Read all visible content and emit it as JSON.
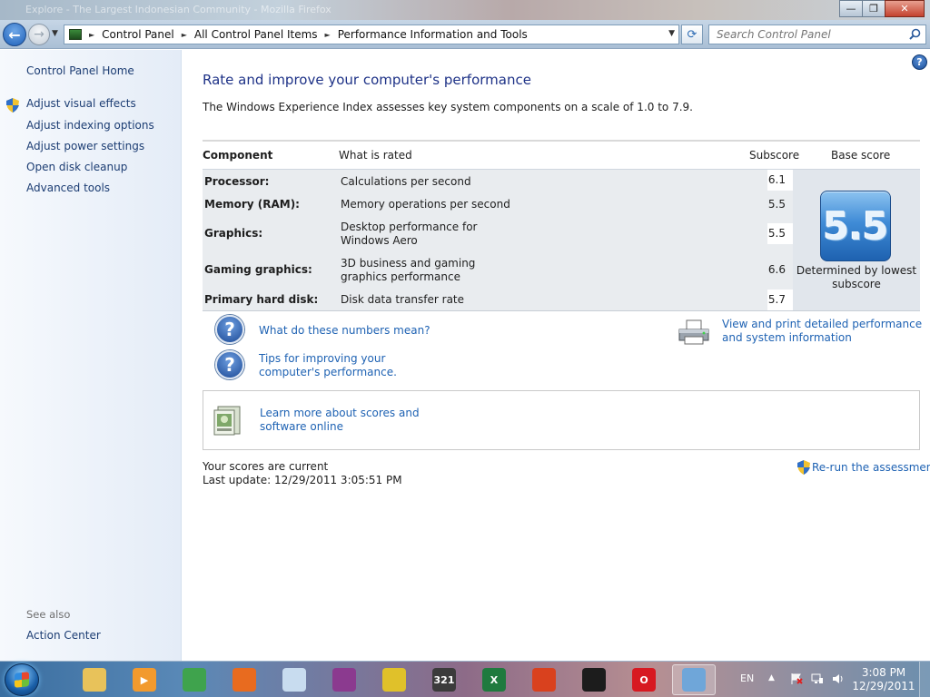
{
  "window": {
    "ghost_title": "Explore - The Largest Indonesian Community - Mozilla Firefox",
    "minimize": "—",
    "maximize": "❐",
    "close": "✕"
  },
  "nav": {
    "back_glyph": "←",
    "forward_glyph": "→",
    "recent_glyph": "▼",
    "breadcrumbs": [
      "Control Panel",
      "All Control Panel Items",
      "Performance Information and Tools"
    ],
    "crumb_sep": "►",
    "dropdown_glyph": "▼",
    "refresh_glyph": "⟳",
    "search_placeholder": "Search Control Panel"
  },
  "sidebar": {
    "home": "Control Panel Home",
    "items": [
      "Adjust visual effects",
      "Adjust indexing options",
      "Adjust power settings",
      "Open disk cleanup",
      "Advanced tools"
    ],
    "see_also_heading": "See also",
    "see_also_items": [
      "Action Center"
    ]
  },
  "main": {
    "help_glyph": "?",
    "title": "Rate and improve your computer's performance",
    "intro": "The Windows Experience Index assesses key system components on a scale of 1.0 to 7.9.",
    "table": {
      "headers": {
        "component": "Component",
        "rated": "What is rated",
        "subscore": "Subscore",
        "base": "Base score"
      },
      "rows": [
        {
          "component": "Processor:",
          "rated": "Calculations per second",
          "subscore": "6.1"
        },
        {
          "component": "Memory (RAM):",
          "rated": "Memory operations per second",
          "subscore": "5.5"
        },
        {
          "component": "Graphics:",
          "rated": "Desktop performance for Windows Aero",
          "subscore": "5.5"
        },
        {
          "component": "Gaming graphics:",
          "rated": "3D business and gaming graphics performance",
          "subscore": "6.6"
        },
        {
          "component": "Primary hard disk:",
          "rated": "Disk data transfer rate",
          "subscore": "5.7"
        }
      ],
      "base_score": "5.5",
      "base_caption": "Determined by lowest subscore"
    },
    "links": {
      "numbers": "What do these numbers mean?",
      "tips": "Tips for improving your computer's performance.",
      "print": "View and print detailed performance and system information",
      "learn": "Learn more about scores and software online"
    },
    "status": {
      "current": "Your scores are current",
      "last_update": "Last update: 12/29/2011 3:05:51 PM",
      "rerun": "Re-run the assessment"
    }
  },
  "taskbar": {
    "apps": [
      {
        "name": "explorer",
        "glyph": "",
        "color": "#e8c25a"
      },
      {
        "name": "media-player",
        "glyph": "▶",
        "color": "#f29a2e"
      },
      {
        "name": "idm",
        "glyph": "",
        "color": "#3fa34d"
      },
      {
        "name": "firefox",
        "glyph": "",
        "color": "#e86b1f"
      },
      {
        "name": "notes",
        "glyph": "",
        "color": "#c8dcef"
      },
      {
        "name": "winrar",
        "glyph": "",
        "color": "#8b3a8f"
      },
      {
        "name": "disc-burner",
        "glyph": "",
        "color": "#e0c12a"
      },
      {
        "name": "media-classic",
        "glyph": "321",
        "color": "#3b3b3b"
      },
      {
        "name": "excel",
        "glyph": "X",
        "color": "#1f7a3e"
      },
      {
        "name": "nero",
        "glyph": "",
        "color": "#d9411e"
      },
      {
        "name": "terminal",
        "glyph": "",
        "color": "#1c1c1c"
      },
      {
        "name": "opera",
        "glyph": "O",
        "color": "#d71921"
      },
      {
        "name": "control-panel",
        "glyph": "",
        "color": "#6fa6d9"
      }
    ],
    "language": "EN",
    "tray_arrow": "▲",
    "time": "3:08 PM",
    "date": "12/29/2011"
  },
  "colors": {
    "link": "#1e62b3",
    "title": "#1e3287",
    "sidebar_link": "#1c3d73"
  }
}
